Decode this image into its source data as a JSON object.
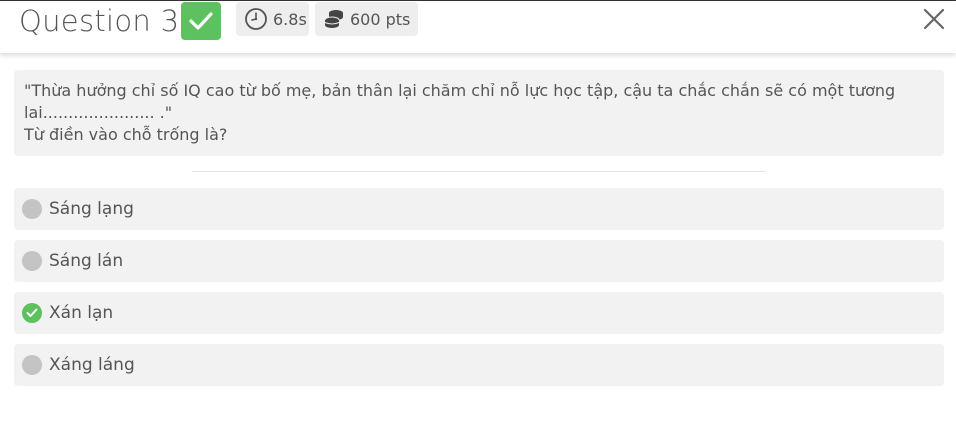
{
  "header": {
    "title": "Question 3",
    "status_icon": "check-icon",
    "time": "6.8s",
    "time_icon": "clock-icon",
    "points": "600 pts",
    "points_icon": "coins-icon",
    "close_icon": "close-icon"
  },
  "question": {
    "line1": "\"Thừa hưởng chỉ số IQ cao từ bố mẹ, bản thân lại chăm chỉ nỗ lực học tập, cậu ta chắc chắn sẽ có một tương",
    "line2": "lai...................... .\"",
    "line3": "Từ điền vào chỗ trống là?"
  },
  "options": [
    {
      "label": "Sáng lạng",
      "state": "unselected"
    },
    {
      "label": "Sáng lán",
      "state": "unselected"
    },
    {
      "label": "Xán lạn",
      "state": "correct"
    },
    {
      "label": "Xáng láng",
      "state": "unselected"
    }
  ],
  "colors": {
    "correct_green": "#5cc15e",
    "text_gray": "#555555",
    "panel_bg": "#f2f2f2",
    "marker_gray": "#c4c4c4"
  }
}
